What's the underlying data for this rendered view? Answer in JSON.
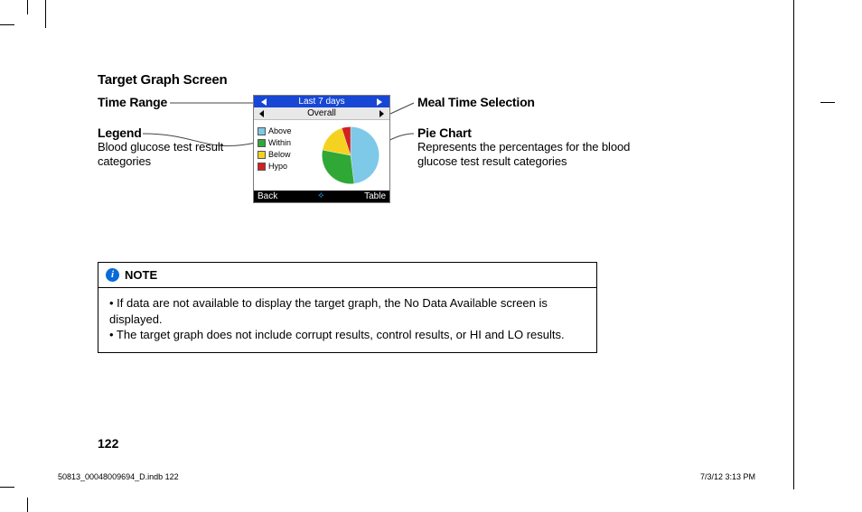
{
  "title": "Target Graph Screen",
  "left": {
    "time_range": {
      "head": "Time Range"
    },
    "legend": {
      "head": "Legend",
      "body": "Blood glucose test result categories"
    }
  },
  "right": {
    "meal": {
      "head": "Meal Time Selection"
    },
    "pie": {
      "head": "Pie Chart",
      "body": "Represents the percentages for the blood glucose test result categories"
    }
  },
  "device": {
    "top": "Last 7 days",
    "sub": "Overall",
    "legend": {
      "above": "Above",
      "within": "Within",
      "below": "Below",
      "hypo": "Hypo"
    },
    "colors": {
      "above": "#7ec8e8",
      "within": "#2fa836",
      "below": "#f4d21f",
      "hypo": "#d4201f"
    },
    "soft_back": "Back",
    "soft_table": "Table"
  },
  "note": {
    "title": "NOTE",
    "b1": "• If data are not available to display the target graph, the No Data Available screen is displayed.",
    "b2": "• The target graph does not include corrupt results, control results, or HI and LO results."
  },
  "page_number": "122",
  "footer": {
    "left": "50813_00048009694_D.indb   122",
    "right": "7/3/12   3:13 PM"
  },
  "chart_data": {
    "type": "pie",
    "title": "Blood glucose test result categories",
    "series": [
      {
        "name": "Above",
        "value": 48,
        "color": "#7ec8e8"
      },
      {
        "name": "Within",
        "value": 30,
        "color": "#2fa836"
      },
      {
        "name": "Below",
        "value": 17,
        "color": "#f4d21f"
      },
      {
        "name": "Hypo",
        "value": 5,
        "color": "#d4201f"
      }
    ]
  }
}
